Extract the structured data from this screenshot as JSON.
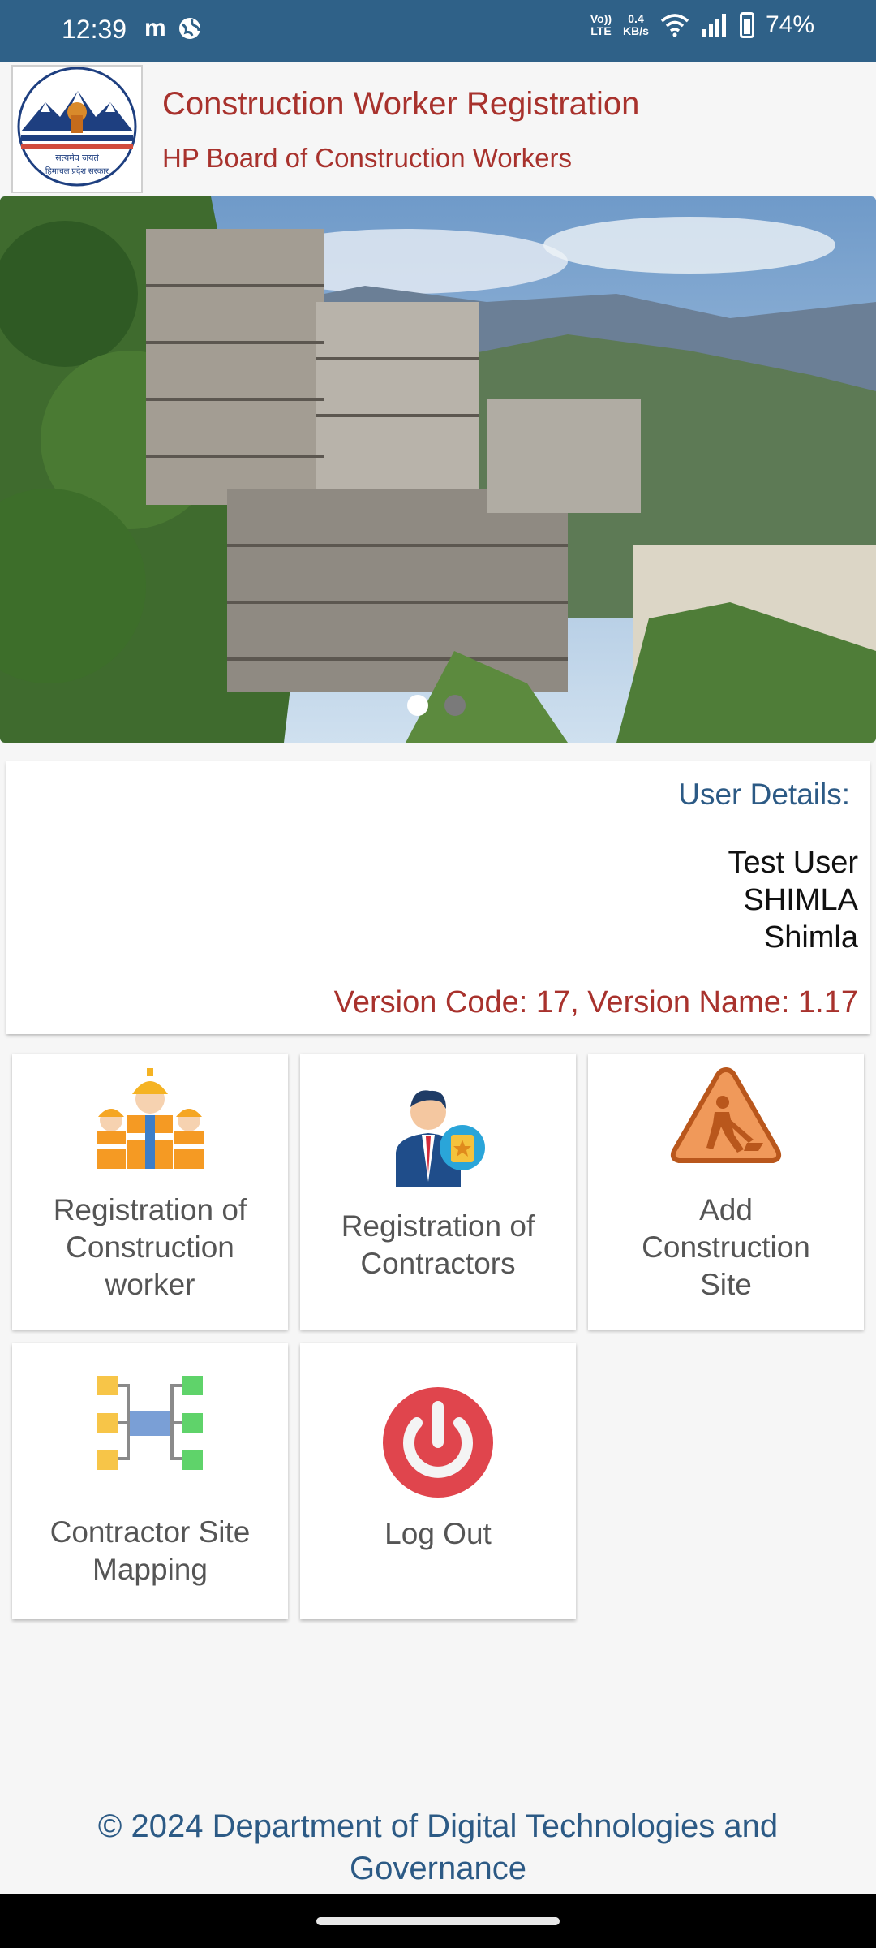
{
  "status_bar": {
    "time": "12:39",
    "network_line1": "0.4",
    "network_line2": "KB/s",
    "volte_line1": "Vo))",
    "volte_line2": "LTE",
    "battery": "74%"
  },
  "header": {
    "title": "Construction Worker Registration",
    "subtitle": "HP Board of Construction Workers",
    "logo_text_line1": "सत्यमेव जयते",
    "logo_text_line2": "हिमाचल प्रदेश सरकार"
  },
  "banner": {
    "slides": 2,
    "active_slide": 1
  },
  "user_details": {
    "label": "User Details:",
    "name": "Test User",
    "district": "SHIMLA",
    "block": "Shimla",
    "version": "Version Code: 17, Version Name: 1.17"
  },
  "tiles": [
    {
      "label_lines": [
        "Registration of",
        "Construction",
        "worker"
      ],
      "icon": "workers-icon"
    },
    {
      "label_lines": [
        "Registration of",
        "Contractors"
      ],
      "icon": "contractor-icon"
    },
    {
      "label_lines": [
        "Add",
        "Construction",
        "Site"
      ],
      "icon": "construction-site-icon"
    },
    {
      "label_lines": [
        "Contractor Site",
        "Mapping"
      ],
      "icon": "site-mapping-icon"
    },
    {
      "label_lines": [
        "Log Out"
      ],
      "icon": "power-icon"
    }
  ],
  "footer": {
    "line1": "© 2024 Department of Digital Technologies and",
    "line2": "Governance"
  },
  "colors": {
    "status_bar": "#2f6188",
    "title_red": "#a8322d",
    "accent_blue": "#2c5a85",
    "logout_red": "#e0454d"
  }
}
